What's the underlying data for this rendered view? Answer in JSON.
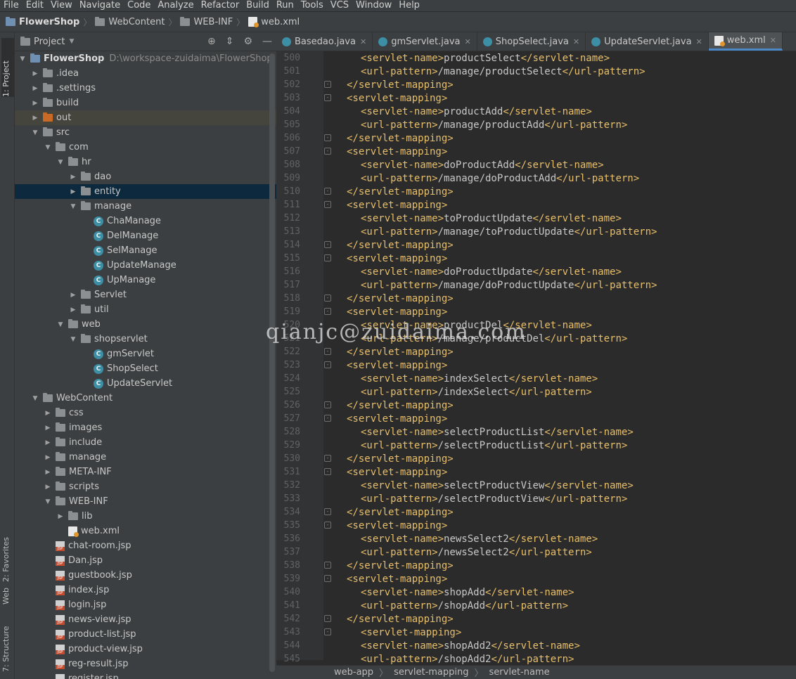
{
  "menu": [
    "File",
    "Edit",
    "View",
    "Navigate",
    "Code",
    "Analyze",
    "Refactor",
    "Build",
    "Run",
    "Tools",
    "VCS",
    "Window",
    "Help"
  ],
  "breadcrumb": [
    "FlowerShop",
    "WebContent",
    "WEB-INF",
    "web.xml"
  ],
  "left_tabs": {
    "project": "1: Project",
    "favorites": "2: Favorites",
    "web": "Web",
    "structure": "7: Structure"
  },
  "project_panel": {
    "title": "Project",
    "rows": [
      {
        "label": "FlowerShop",
        "extra": "D:\\workspace-zuidaima\\FlowerShop",
        "depth": 0,
        "arrow": "down",
        "icon": "folder-blue"
      },
      {
        "label": ".idea",
        "depth": 1,
        "arrow": "right",
        "icon": "folder"
      },
      {
        "label": ".settings",
        "depth": 1,
        "arrow": "right",
        "icon": "folder"
      },
      {
        "label": "build",
        "depth": 1,
        "arrow": "right",
        "icon": "folder"
      },
      {
        "label": "out",
        "depth": 1,
        "arrow": "right",
        "icon": "folder-orange",
        "state": "highlight"
      },
      {
        "label": "src",
        "depth": 1,
        "arrow": "down",
        "icon": "folder"
      },
      {
        "label": "com",
        "depth": 2,
        "arrow": "down",
        "icon": "folder"
      },
      {
        "label": "hr",
        "depth": 3,
        "arrow": "down",
        "icon": "folder"
      },
      {
        "label": "dao",
        "depth": 4,
        "arrow": "right",
        "icon": "folder"
      },
      {
        "label": "entity",
        "depth": 4,
        "arrow": "right",
        "icon": "folder",
        "state": "selected"
      },
      {
        "label": "manage",
        "depth": 4,
        "arrow": "down",
        "icon": "folder"
      },
      {
        "label": "ChaManage",
        "depth": 5,
        "arrow": "",
        "icon": "class"
      },
      {
        "label": "DelManage",
        "depth": 5,
        "arrow": "",
        "icon": "class"
      },
      {
        "label": "SelManage",
        "depth": 5,
        "arrow": "",
        "icon": "class"
      },
      {
        "label": "UpdateManage",
        "depth": 5,
        "arrow": "",
        "icon": "class"
      },
      {
        "label": "UpManage",
        "depth": 5,
        "arrow": "",
        "icon": "class"
      },
      {
        "label": "Servlet",
        "depth": 4,
        "arrow": "right",
        "icon": "folder"
      },
      {
        "label": "util",
        "depth": 4,
        "arrow": "right",
        "icon": "folder"
      },
      {
        "label": "web",
        "depth": 3,
        "arrow": "down",
        "icon": "folder"
      },
      {
        "label": "shopservlet",
        "depth": 4,
        "arrow": "down",
        "icon": "folder"
      },
      {
        "label": "gmServlet",
        "depth": 5,
        "arrow": "",
        "icon": "class"
      },
      {
        "label": "ShopSelect",
        "depth": 5,
        "arrow": "",
        "icon": "class"
      },
      {
        "label": "UpdateServlet",
        "depth": 5,
        "arrow": "",
        "icon": "class"
      },
      {
        "label": "WebContent",
        "depth": 1,
        "arrow": "down",
        "icon": "folder"
      },
      {
        "label": "css",
        "depth": 2,
        "arrow": "right",
        "icon": "folder"
      },
      {
        "label": "images",
        "depth": 2,
        "arrow": "right",
        "icon": "folder"
      },
      {
        "label": "include",
        "depth": 2,
        "arrow": "right",
        "icon": "folder"
      },
      {
        "label": "manage",
        "depth": 2,
        "arrow": "right",
        "icon": "folder"
      },
      {
        "label": "META-INF",
        "depth": 2,
        "arrow": "right",
        "icon": "folder"
      },
      {
        "label": "scripts",
        "depth": 2,
        "arrow": "right",
        "icon": "folder"
      },
      {
        "label": "WEB-INF",
        "depth": 2,
        "arrow": "down",
        "icon": "folder"
      },
      {
        "label": "lib",
        "depth": 3,
        "arrow": "right",
        "icon": "folder"
      },
      {
        "label": "web.xml",
        "depth": 3,
        "arrow": "",
        "icon": "xml"
      },
      {
        "label": "chat-room.jsp",
        "depth": 2,
        "arrow": "",
        "icon": "jsp"
      },
      {
        "label": "Dan.jsp",
        "depth": 2,
        "arrow": "",
        "icon": "jsp"
      },
      {
        "label": "guestbook.jsp",
        "depth": 2,
        "arrow": "",
        "icon": "jsp"
      },
      {
        "label": "index.jsp",
        "depth": 2,
        "arrow": "",
        "icon": "jsp"
      },
      {
        "label": "login.jsp",
        "depth": 2,
        "arrow": "",
        "icon": "jsp"
      },
      {
        "label": "news-view.jsp",
        "depth": 2,
        "arrow": "",
        "icon": "jsp"
      },
      {
        "label": "product-list.jsp",
        "depth": 2,
        "arrow": "",
        "icon": "jsp"
      },
      {
        "label": "product-view.jsp",
        "depth": 2,
        "arrow": "",
        "icon": "jsp"
      },
      {
        "label": "reg-result.jsp",
        "depth": 2,
        "arrow": "",
        "icon": "jsp"
      },
      {
        "label": "register.jsp",
        "depth": 2,
        "arrow": "",
        "icon": "jsp"
      }
    ]
  },
  "tabs": [
    {
      "label": "Basedao.java",
      "icon": "class",
      "active": false
    },
    {
      "label": "gmServlet.java",
      "icon": "class",
      "active": false
    },
    {
      "label": "ShopSelect.java",
      "icon": "class",
      "active": false
    },
    {
      "label": "UpdateServlet.java",
      "icon": "class",
      "active": false
    },
    {
      "label": "web.xml",
      "icon": "xml",
      "active": true
    }
  ],
  "code_lines": [
    {
      "n": "500",
      "i": 2,
      "t": "<servlet-name>",
      "v": "productSelect",
      "c": "</servlet-name>"
    },
    {
      "n": "501",
      "i": 2,
      "t": "<url-pattern>",
      "v": "/manage/productSelect",
      "c": "</url-pattern>"
    },
    {
      "n": "502",
      "i": 1,
      "t": "</servlet-mapping>",
      "v": "",
      "c": "",
      "fold": "-"
    },
    {
      "n": "503",
      "i": 1,
      "t": "<servlet-mapping>",
      "v": "",
      "c": "",
      "fold": "-"
    },
    {
      "n": "504",
      "i": 2,
      "t": "<servlet-name>",
      "v": "productAdd",
      "c": "</servlet-name>"
    },
    {
      "n": "505",
      "i": 2,
      "t": "<url-pattern>",
      "v": "/manage/productAdd",
      "c": "</url-pattern>"
    },
    {
      "n": "506",
      "i": 1,
      "t": "</servlet-mapping>",
      "v": "",
      "c": "",
      "fold": "-"
    },
    {
      "n": "507",
      "i": 1,
      "t": "<servlet-mapping>",
      "v": "",
      "c": "",
      "fold": "-"
    },
    {
      "n": "508",
      "i": 2,
      "t": "<servlet-name>",
      "v": "doProductAdd",
      "c": "</servlet-name>"
    },
    {
      "n": "509",
      "i": 2,
      "t": "<url-pattern>",
      "v": "/manage/doProductAdd",
      "c": "</url-pattern>"
    },
    {
      "n": "510",
      "i": 1,
      "t": "</servlet-mapping>",
      "v": "",
      "c": "",
      "fold": "-"
    },
    {
      "n": "511",
      "i": 1,
      "t": "<servlet-mapping>",
      "v": "",
      "c": "",
      "fold": "-"
    },
    {
      "n": "512",
      "i": 2,
      "t": "<servlet-name>",
      "v": "toProductUpdate",
      "c": "</servlet-name>"
    },
    {
      "n": "513",
      "i": 2,
      "t": "<url-pattern>",
      "v": "/manage/toProductUpdate",
      "c": "</url-pattern>"
    },
    {
      "n": "514",
      "i": 1,
      "t": "</servlet-mapping>",
      "v": "",
      "c": "",
      "fold": "-"
    },
    {
      "n": "515",
      "i": 1,
      "t": "<servlet-mapping>",
      "v": "",
      "c": "",
      "fold": "-"
    },
    {
      "n": "516",
      "i": 2,
      "t": "<servlet-name>",
      "v": "doProductUpdate",
      "c": "</servlet-name>"
    },
    {
      "n": "517",
      "i": 2,
      "t": "<url-pattern>",
      "v": "/manage/doProductUpdate",
      "c": "</url-pattern>"
    },
    {
      "n": "518",
      "i": 1,
      "t": "</servlet-mapping>",
      "v": "",
      "c": "",
      "fold": "-"
    },
    {
      "n": "519",
      "i": 1,
      "t": "<servlet-mapping>",
      "v": "",
      "c": "",
      "fold": "-"
    },
    {
      "n": "520",
      "i": 2,
      "t": "<servlet-name>",
      "v": "productDel",
      "c": "</servlet-name>"
    },
    {
      "n": "521",
      "i": 2,
      "t": "<url-pattern>",
      "v": "/manage/productDel",
      "c": "</url-pattern>"
    },
    {
      "n": "522",
      "i": 1,
      "t": "</servlet-mapping>",
      "v": "",
      "c": "",
      "fold": "-"
    },
    {
      "n": "523",
      "i": 1,
      "t": "<servlet-mapping>",
      "v": "",
      "c": "",
      "fold": "-"
    },
    {
      "n": "524",
      "i": 2,
      "t": "<servlet-name>",
      "v": "indexSelect",
      "c": "</servlet-name>"
    },
    {
      "n": "525",
      "i": 2,
      "t": "<url-pattern>",
      "v": "/indexSelect",
      "c": "</url-pattern>"
    },
    {
      "n": "526",
      "i": 1,
      "t": "</servlet-mapping>",
      "v": "",
      "c": "",
      "fold": "-"
    },
    {
      "n": "527",
      "i": 1,
      "t": "<servlet-mapping>",
      "v": "",
      "c": "",
      "fold": "-"
    },
    {
      "n": "528",
      "i": 2,
      "t": "<servlet-name>",
      "v": "selectProductList",
      "c": "</servlet-name>"
    },
    {
      "n": "529",
      "i": 2,
      "t": "<url-pattern>",
      "v": "/selectProductList",
      "c": "</url-pattern>"
    },
    {
      "n": "530",
      "i": 1,
      "t": "</servlet-mapping>",
      "v": "",
      "c": "",
      "fold": "-"
    },
    {
      "n": "531",
      "i": 1,
      "t": "<servlet-mapping>",
      "v": "",
      "c": "",
      "fold": "-"
    },
    {
      "n": "532",
      "i": 2,
      "t": "<servlet-name>",
      "v": "selectProductView",
      "c": "</servlet-name>"
    },
    {
      "n": "533",
      "i": 2,
      "t": "<url-pattern>",
      "v": "/selectProductView",
      "c": "</url-pattern>"
    },
    {
      "n": "534",
      "i": 1,
      "t": "</servlet-mapping>",
      "v": "",
      "c": "",
      "fold": "-"
    },
    {
      "n": "535",
      "i": 1,
      "t": "<servlet-mapping>",
      "v": "",
      "c": "",
      "fold": "-"
    },
    {
      "n": "536",
      "i": 2,
      "t": "<servlet-name>",
      "v": "newsSelect2",
      "c": "</servlet-name>"
    },
    {
      "n": "537",
      "i": 2,
      "t": "<url-pattern>",
      "v": "/newsSelect2",
      "c": "</url-pattern>"
    },
    {
      "n": "538",
      "i": 1,
      "t": "</servlet-mapping>",
      "v": "",
      "c": "",
      "fold": "-"
    },
    {
      "n": "539",
      "i": 1,
      "t": "<servlet-mapping>",
      "v": "",
      "c": "",
      "fold": "-"
    },
    {
      "n": "540",
      "i": 2,
      "t": "<servlet-name>",
      "v": "shopAdd",
      "c": "</servlet-name>"
    },
    {
      "n": "541",
      "i": 2,
      "t": "<url-pattern>",
      "v": "/shopAdd",
      "c": "</url-pattern>"
    },
    {
      "n": "542",
      "i": 1,
      "t": "</servlet-mapping>",
      "v": "",
      "c": "",
      "fold": "-"
    },
    {
      "n": "543",
      "i": 2,
      "t": "<servlet-mapping>",
      "v": "",
      "c": "",
      "fold": "-"
    },
    {
      "n": "544",
      "i": 2,
      "t": "<servlet-name>",
      "v": "shopAdd2",
      "c": "</servlet-name>"
    },
    {
      "n": "545",
      "i": 2,
      "t": "<url-pattern>",
      "v": "/shopAdd2",
      "c": "</url-pattern>"
    }
  ],
  "status_path": [
    "web-app",
    "servlet-mapping",
    "servlet-name"
  ],
  "watermark": "qianjc@zuidaima.com",
  "colors": {
    "tag": "#e8bf6a",
    "text": "#c8c8c8",
    "selection": "#0d293e",
    "tab_accent": "#4a88c7"
  }
}
